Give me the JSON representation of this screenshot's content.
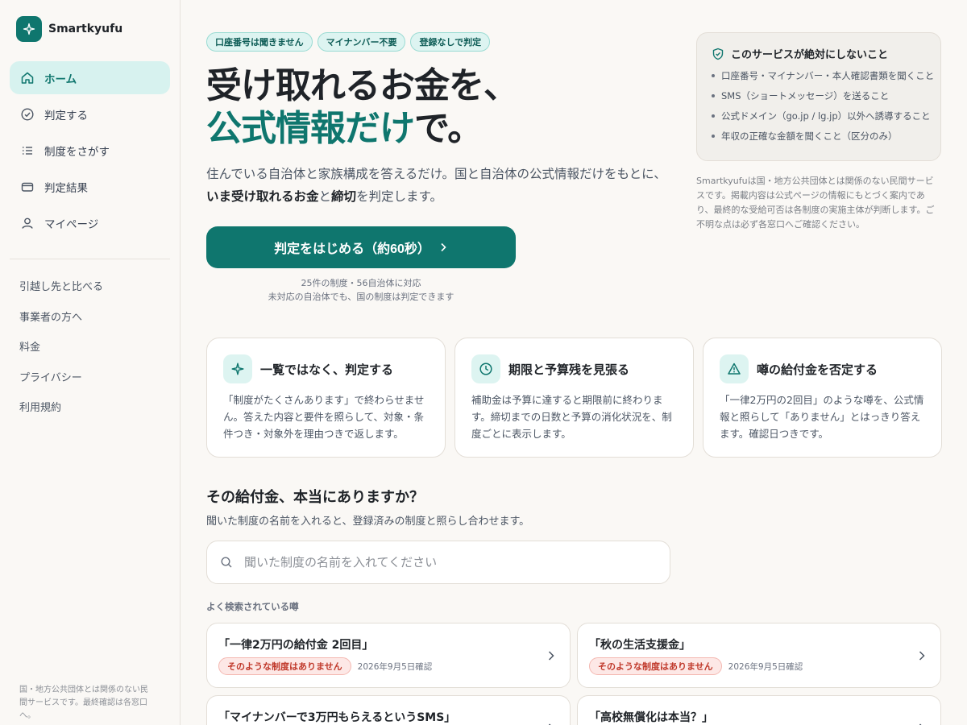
{
  "brand": {
    "name": "Smartkyufu"
  },
  "nav": {
    "items": [
      {
        "label": "ホーム",
        "icon": "home-icon",
        "active": true
      },
      {
        "label": "判定する",
        "icon": "check-circle-icon"
      },
      {
        "label": "制度をさがす",
        "icon": "list-icon"
      },
      {
        "label": "判定結果",
        "icon": "wallet-icon"
      },
      {
        "label": "マイページ",
        "icon": "user-icon"
      }
    ],
    "sub_items": [
      "引越し先と比べる",
      "事業者の方へ",
      "料金",
      "プライバシー",
      "利用規約"
    ],
    "footer": "国・地方公共団体とは関係のない民間サービスです。最終確認は各窓口へ。"
  },
  "hero": {
    "chips": [
      "口座番号は聞きません",
      "マイナンバー不要",
      "登録なしで判定"
    ],
    "title_line1": "受け取れるお金を、",
    "title_accent": "公式情報だけ",
    "title_tail": "で。",
    "desc_1": "住んでいる自治体と家族構成を答えるだけ。国と自治体の公式情報だけをもとに、",
    "desc_bold_1": "いま受け取れるお金",
    "desc_2": "と",
    "desc_bold_2": "締切",
    "desc_3": "を判定します。",
    "cta_label": "判定をはじめる（約60秒）",
    "cta_note_1": "25件の制度・56自治体に対応",
    "cta_note_2": "未対応の自治体でも、国の制度は判定できます"
  },
  "never": {
    "title": "このサービスが絶対にしないこと",
    "items": [
      "口座番号・マイナンバー・本人確認書類を聞くこと",
      "SMS（ショートメッセージ）を送ること",
      "公式ドメイン（go.jp / lg.jp）以外へ誘導すること",
      "年収の正確な金額を聞くこと（区分のみ）"
    ],
    "disclaimer": "Smartkyufuは国・地方公共団体とは関係のない民間サービスです。掲載内容は公式ページの情報にもとづく案内であり、最終的な受給可否は各制度の実施主体が判断します。ご不明な点は必ず各窓口へご確認ください。"
  },
  "features": [
    {
      "icon": "sparkle-icon",
      "title": "一覧ではなく、判定する",
      "body": "「制度がたくさんあります」で終わらせません。答えた内容と要件を照らして、対象・条件つき・対象外を理由つきで返します。"
    },
    {
      "icon": "clock-icon",
      "title": "期限と予算残を見張る",
      "body": "補助金は予算に達すると期限前に終わります。締切までの日数と予算の消化状況を、制度ごとに表示します。"
    },
    {
      "icon": "warning-icon",
      "title": "噂の給付金を否定する",
      "body": "「一律2万円の2回目」のような噂を、公式情報と照らして「ありません」とはっきり答えます。確認日つきです。"
    }
  ],
  "rumor": {
    "title": "その給付金、本当にありますか？",
    "desc": "聞いた制度の名前を入れると、登録済みの制度と照らし合わせます。",
    "search_placeholder": "聞いた制度の名前を入れてください",
    "popular_label": "よく検索されている噂",
    "cards": [
      {
        "name": "「一律2万円の給付金 2回目」",
        "badge": "そのような制度はありません",
        "date": "2026年9月5日確認"
      },
      {
        "name": "「秋の生活支援金」",
        "badge": "そのような制度はありません",
        "date": "2026年9月5日確認"
      },
      {
        "name": "「マイナンバーで3万円もらえるというSMS」",
        "badge": "",
        "date": ""
      },
      {
        "name": "「高校無償化は本当？」",
        "badge": "",
        "date": ""
      }
    ]
  },
  "colors": {
    "accent": "#0f766e",
    "accent_light": "#ddf4f1",
    "danger": "#c0392b",
    "bg": "#faf8f5"
  }
}
